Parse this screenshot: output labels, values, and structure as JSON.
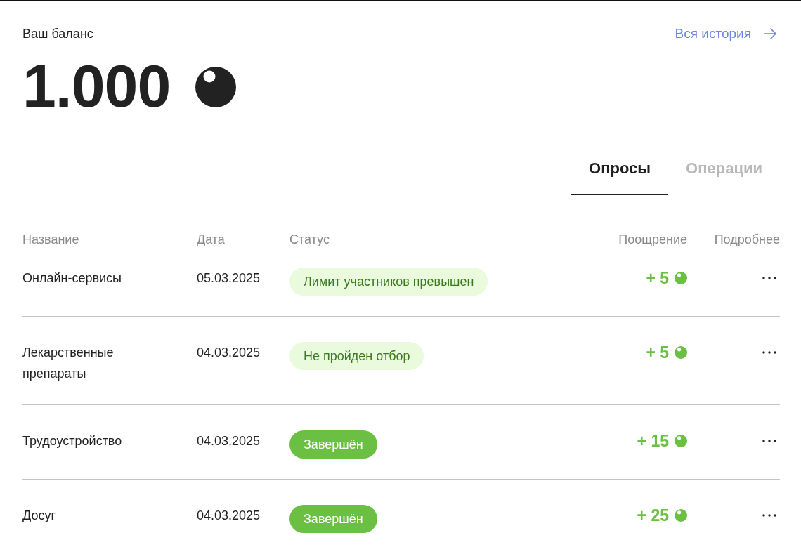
{
  "balance": {
    "label": "Ваш баланс",
    "amount": "1.000"
  },
  "history_link": {
    "label": "Вся история"
  },
  "tabs": [
    {
      "label": "Опросы",
      "selected": true
    },
    {
      "label": "Операции",
      "selected": false
    }
  ],
  "table": {
    "columns": [
      "Название",
      "Дата",
      "Статус",
      "Поощрение",
      "Подробнее"
    ],
    "rows": [
      {
        "name": "Онлайн-сервисы",
        "date": "05.03.2025",
        "status": {
          "label": "Лимит участников превышен",
          "kind": "declined"
        },
        "reward": "+ 5"
      },
      {
        "name": "Лекарственные препараты",
        "date": "04.03.2025",
        "status": {
          "label": "Не пройден отбор",
          "kind": "declined"
        },
        "reward": "+ 5"
      },
      {
        "name": "Трудоустройство",
        "date": "04.03.2025",
        "status": {
          "label": "Завершён",
          "kind": "completed"
        },
        "reward": "+ 15"
      },
      {
        "name": "Досуг",
        "date": "04.03.2025",
        "status": {
          "label": "Завершён",
          "kind": "completed"
        },
        "reward": "+ 25"
      }
    ]
  }
}
